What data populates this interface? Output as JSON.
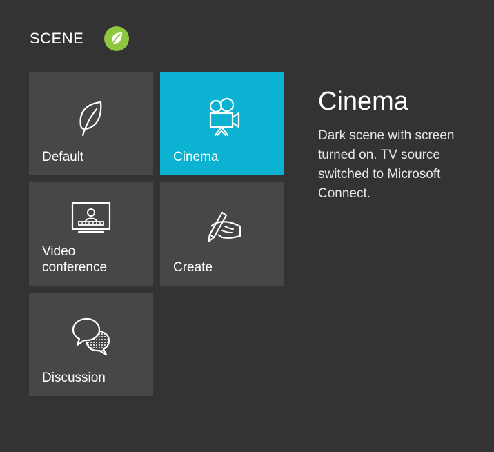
{
  "header": {
    "title": "SCENE",
    "logo_icon": "leaf-logo"
  },
  "accent_color": "#0cb2d1",
  "brand_color": "#8dc63f",
  "tiles": [
    {
      "label": "Default",
      "icon": "leaf-icon",
      "selected": false
    },
    {
      "label": "Cinema",
      "icon": "movie-camera-icon",
      "selected": true
    },
    {
      "label": "Video\nconference",
      "icon": "video-conference-icon",
      "selected": false
    },
    {
      "label": "Create",
      "icon": "hand-writing-icon",
      "selected": false
    },
    {
      "label": "Discussion",
      "icon": "speech-bubbles-icon",
      "selected": false
    }
  ],
  "detail": {
    "title": "Cinema",
    "description": "Dark scene with screen turned on. TV source switched to Microsoft Connect."
  }
}
